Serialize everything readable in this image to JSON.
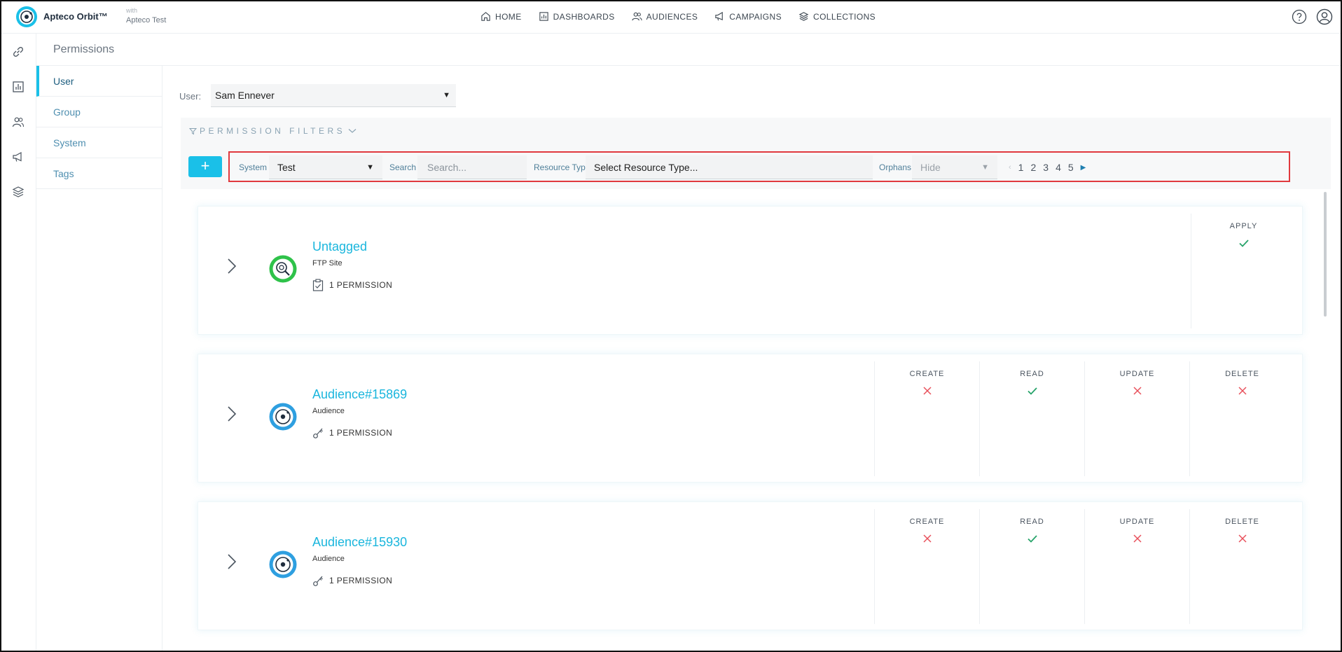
{
  "app": {
    "brand": "Apteco Orbit™",
    "with_label": "with",
    "subtitle": "Apteco Test"
  },
  "nav": {
    "items": [
      {
        "label": "HOME",
        "icon": "home-icon"
      },
      {
        "label": "DASHBOARDS",
        "icon": "dashboards-icon"
      },
      {
        "label": "AUDIENCES",
        "icon": "audiences-icon"
      },
      {
        "label": "CAMPAIGNS",
        "icon": "campaigns-icon"
      },
      {
        "label": "COLLECTIONS",
        "icon": "collections-icon"
      }
    ]
  },
  "page": {
    "title": "Permissions"
  },
  "subnav": {
    "items": [
      {
        "label": "User",
        "active": true
      },
      {
        "label": "Group"
      },
      {
        "label": "System"
      },
      {
        "label": "Tags"
      }
    ]
  },
  "user_selector": {
    "label": "User:",
    "value": "Sam Ennever"
  },
  "filters": {
    "title": "PERMISSION FILTERS",
    "add_label": "+",
    "system_label": "System",
    "system_value": "Test",
    "search_label": "Search",
    "search_placeholder": "Search...",
    "resource_type_label": "Resource Type",
    "resource_type_value": "Select Resource Type...",
    "orphans_label": "Orphans",
    "orphans_value": "Hide",
    "pages": [
      "1",
      "2",
      "3",
      "4",
      "5"
    ]
  },
  "cards": [
    {
      "name": "Untagged",
      "type": "FTP Site",
      "permission_count": "1 PERMISSION",
      "icon": "ftp-site-icon",
      "columns": [
        {
          "label": "APPLY",
          "granted": true
        }
      ]
    },
    {
      "name": "Audience#15869",
      "type": "Audience",
      "permission_count": "1 PERMISSION",
      "icon": "audience-icon",
      "columns": [
        {
          "label": "CREATE",
          "granted": false
        },
        {
          "label": "READ",
          "granted": true
        },
        {
          "label": "UPDATE",
          "granted": false
        },
        {
          "label": "DELETE",
          "granted": false
        }
      ]
    },
    {
      "name": "Audience#15930",
      "type": "Audience",
      "permission_count": "1 PERMISSION",
      "icon": "audience-icon",
      "columns": [
        {
          "label": "CREATE",
          "granted": false
        },
        {
          "label": "READ",
          "granted": true
        },
        {
          "label": "UPDATE",
          "granted": false
        },
        {
          "label": "DELETE",
          "granted": false
        }
      ]
    }
  ],
  "colors": {
    "accent": "#1ac0e8",
    "granted": "#27a36a",
    "denied": "#e8505b",
    "highlight": "#e0393e"
  }
}
